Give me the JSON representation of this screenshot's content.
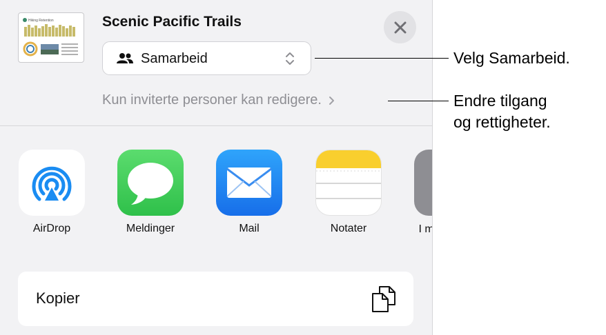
{
  "share_sheet": {
    "thumbnail_title": "Hiking Retention",
    "title": "Scenic Pacific Trails",
    "collaboration_mode": "Samarbeid",
    "access_info": "Kun inviterte personer kan redigere.",
    "apps": [
      {
        "name": "AirDrop",
        "icon": "airdrop-icon"
      },
      {
        "name": "Meldinger",
        "icon": "messages-icon"
      },
      {
        "name": "Mail",
        "icon": "mail-icon"
      },
      {
        "name": "Notater",
        "icon": "notes-icon"
      },
      {
        "name": "I me",
        "icon": "more-app-icon"
      }
    ],
    "copy_label": "Kopier",
    "colors": {
      "sheet_bg": "#f2f2f4",
      "messages_green": "#34c759",
      "mail_blue": "#1e7cf2",
      "notes_yellow": "#f9cf2e",
      "airdrop_blue": "#1a8cf2"
    }
  },
  "callouts": {
    "select_collab": "Velg Samarbeid.",
    "change_access_line1": "Endre tilgang",
    "change_access_line2": "og rettigheter."
  }
}
